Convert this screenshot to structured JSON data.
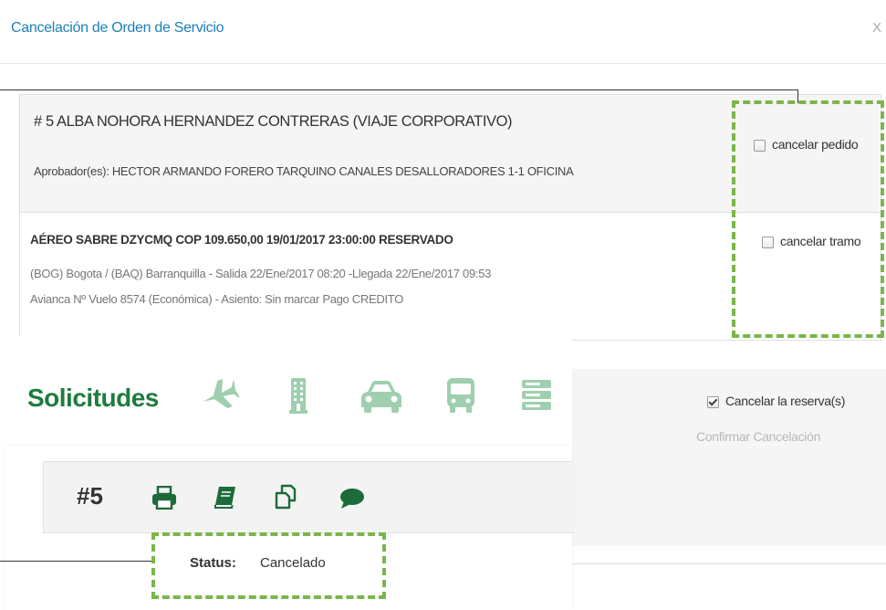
{
  "modal": {
    "title": "Cancelación de Orden de Servicio",
    "close_label": "X"
  },
  "order": {
    "passenger": "# 5  ALBA NOHORA HERNANDEZ CONTRERAS (VIAJE CORPORATIVO)",
    "approvers": "Aprobador(es): HECTOR ARMANDO FORERO TARQUINO CANALES DESALLORADORES 1-1 OFICINA",
    "cancel_order_label": "cancelar pedido",
    "segment": {
      "title": "AÉREO SABRE DZYCMQ COP 109.650,00 19/01/2017 23:00:00 RESERVADO",
      "route": "(BOG) Bogota / (BAQ) Barranquilla - Salida 22/Ene/2017 08:20 -Llegada 22/Ene/2017 09:53",
      "flight": "Avianca Nº Vuelo 8574 (Económica) - Asiento: Sin marcar Pago CREDITO",
      "cancel_segment_label": "cancelar tramo"
    }
  },
  "reservation": {
    "cancel_reservation_label": "Cancelar la reserva(s)",
    "cancel_reservation_checked": true,
    "confirm_label": "Confirmar Cancelación"
  },
  "requests": {
    "title": "Solicitudes",
    "nav_icons": [
      "plane-icon",
      "building-icon",
      "car-icon",
      "bus-icon",
      "server-icon"
    ],
    "order_number": "#5",
    "tools": [
      "print-icon",
      "book-icon",
      "copy-icon",
      "comment-icon"
    ],
    "status_label": "Status:",
    "status_value": "Cancelado"
  },
  "colors": {
    "title_blue": "#1f7fb8",
    "brand_green": "#1e7c3e",
    "icon_green": "#9fcfae",
    "dash_green": "#7ab648"
  }
}
